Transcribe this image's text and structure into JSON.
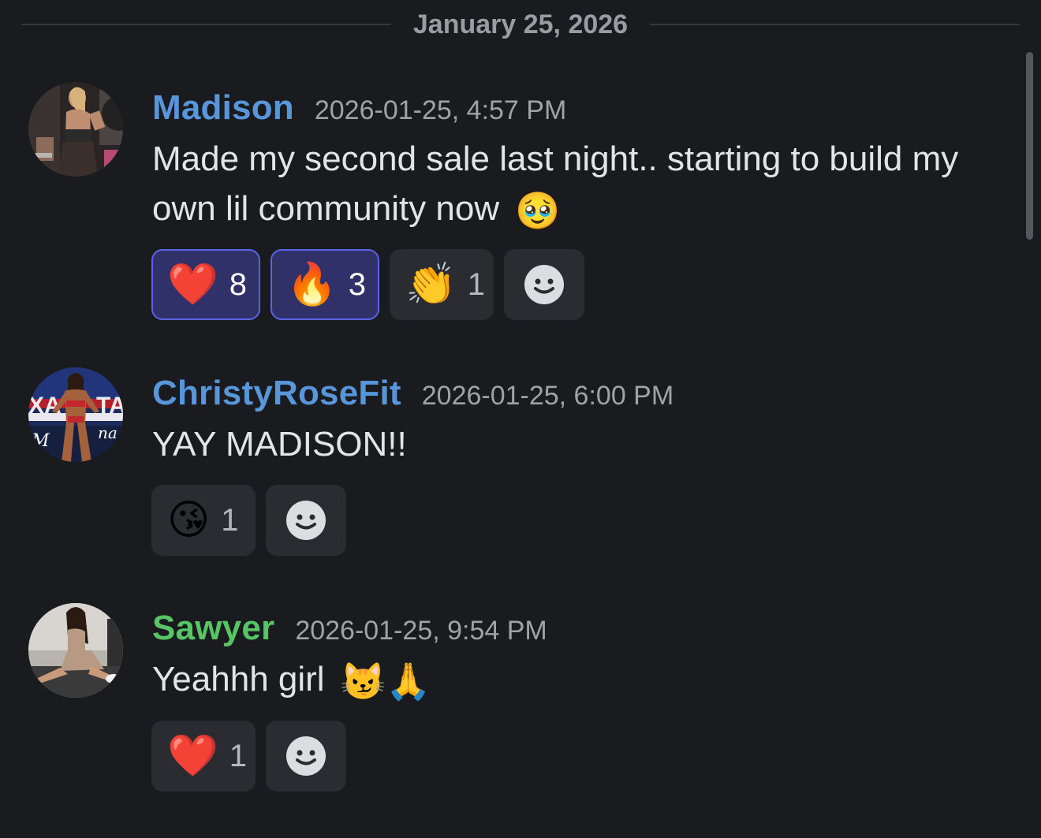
{
  "date_divider": "January 25, 2026",
  "colors": {
    "background": "#1a1b1e",
    "username_blue": "#5896dc",
    "username_green": "#57c566",
    "reaction_active_bg": "#2f3168",
    "reaction_active_border": "#5b63e6"
  },
  "messages": [
    {
      "username": "Madison",
      "username_color": "#5896dc",
      "timestamp": "2026-01-25, 4:57 PM",
      "text_line1": "Made my second sale last night.. starting to build my",
      "text_line2": "own lil community now",
      "inline_emojis": [
        "🥹"
      ],
      "reactions": [
        {
          "emoji": "❤️",
          "count": "8",
          "active": true
        },
        {
          "emoji": "🔥",
          "count": "3",
          "active": true
        },
        {
          "emoji": "👏",
          "count": "1",
          "active": false
        }
      ]
    },
    {
      "username": "ChristyRoseFit",
      "username_color": "#5896dc",
      "timestamp": "2026-01-25, 6:00 PM",
      "text": "YAY MADISON!!",
      "reactions": [
        {
          "emoji": "😘",
          "count": "1",
          "active": false
        }
      ]
    },
    {
      "username": "Sawyer",
      "username_color": "#57c566",
      "timestamp": "2026-01-25, 9:54 PM",
      "text": "Yeahhh girl",
      "inline_emojis": [
        "😼",
        "🙏"
      ],
      "reactions": [
        {
          "emoji": "❤️",
          "count": "1",
          "active": false
        }
      ]
    }
  ]
}
